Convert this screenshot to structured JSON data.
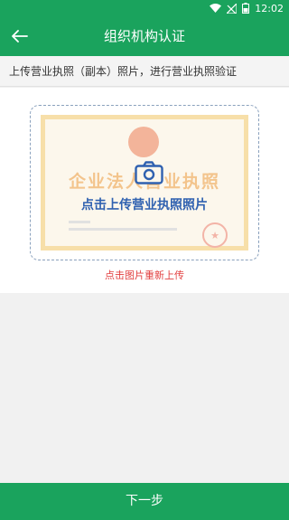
{
  "status_bar": {
    "time": "12:02",
    "icons": [
      "wifi-icon",
      "no-sim-icon",
      "battery-icon"
    ]
  },
  "header": {
    "back_icon": "arrow-back-icon",
    "title": "组织机构认证"
  },
  "instruction": "上传营业执照（副本）照片，进行营业执照验证",
  "upload": {
    "license_heading": "企业法人营业执照",
    "camera_icon": "camera-icon",
    "hint": "点击上传营业执照照片",
    "reupload_hint": "点击图片重新上传"
  },
  "footer": {
    "next_label": "下一步"
  },
  "colors": {
    "brand_green": "#1aa35d",
    "hint_blue": "#2f61b0",
    "warning_red": "#e24040"
  }
}
